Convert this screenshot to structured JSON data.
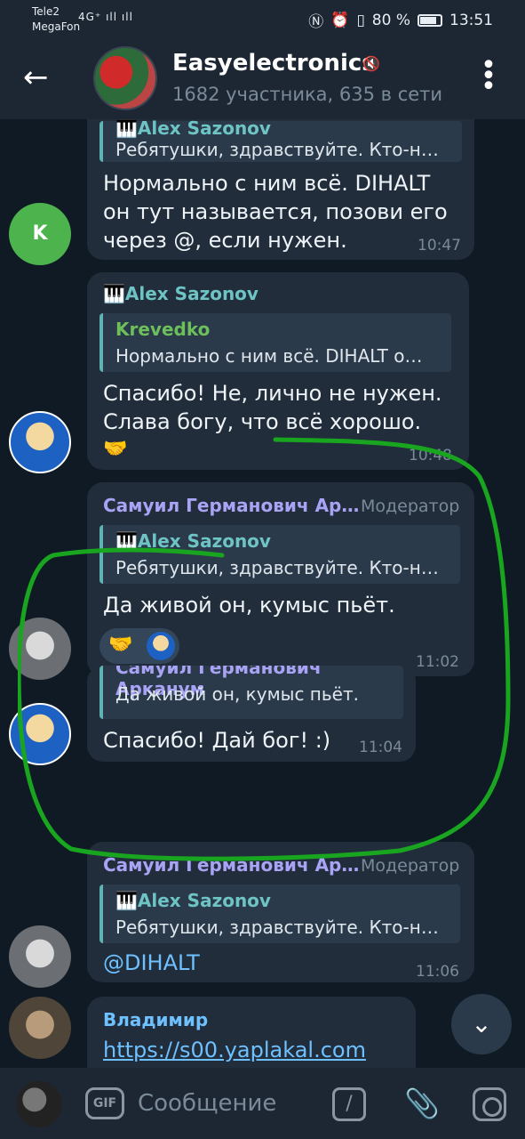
{
  "status": {
    "carrier1": "Tele2",
    "carrier2": "MegaFon",
    "signal": "4G⁺ ıll ıll",
    "battery": "80 %",
    "time": "13:51"
  },
  "header": {
    "title": "Easyelectronics",
    "subtitle": "1682 участника, 635 в сети"
  },
  "messages": [
    {
      "reply_name": "🎹Alex Sazonov",
      "reply_text": "Ребятушки, здравствуйте. Кто-н…",
      "text1": "Нормально с ним всё. DIHALT",
      "text2": "он тут называется, позови его",
      "text3": "через @, если нужен.",
      "time": "10:47",
      "avatar_letter": "K"
    },
    {
      "sender": "🎹Alex Sazonov",
      "reply_name": "Krevedko",
      "reply_text": "Нормально с ним всё. DIHALT о…",
      "text1": "Спасибо! Не, лично не нужен.",
      "text2": "Слава богу, что всё хорошо.",
      "reaction": "🤝",
      "time": "10:48"
    },
    {
      "sender": "Самуил Германович Ар…",
      "role": "Модератор",
      "reply_name": "🎹Alex Sazonov",
      "reply_text": "Ребятушки, здравствуйте. Кто-н…",
      "text1": "Да живой он, кумыс пьёт.",
      "reaction": "🤝",
      "time": "11:02"
    },
    {
      "reply_name": "Самуил Германович Арканум",
      "reply_text": "Да живой он, кумыс пьёт.",
      "text1": "Спасибо! Дай бог! :)",
      "time": "11:04"
    },
    {
      "sender": "Самуил Германович Ар…",
      "role": "Модератор",
      "reply_name": "🎹Alex Sazonov",
      "reply_text": "Ребятушки, здравствуйте. Кто-н…",
      "text1": "@DIHALT",
      "time": "11:06"
    },
    {
      "sender": "Владимир",
      "link": "https://s00.yaplakal.com"
    }
  ],
  "input": {
    "placeholder": "Сообщение",
    "gif_label": "GIF",
    "cmd_label": "/"
  },
  "icons": {
    "back": "back-arrow-icon",
    "menu": "more-vertical-icon",
    "mute": "muted-icon",
    "scroll": "chevron-down-icon",
    "attach": "paperclip-icon",
    "camera": "camera-icon"
  },
  "colors": {
    "background": "#0f1a24",
    "bubble": "#212d3b",
    "accent": "#6ec4c4",
    "link": "#6ec0ff",
    "annotation": "#19a51f"
  }
}
